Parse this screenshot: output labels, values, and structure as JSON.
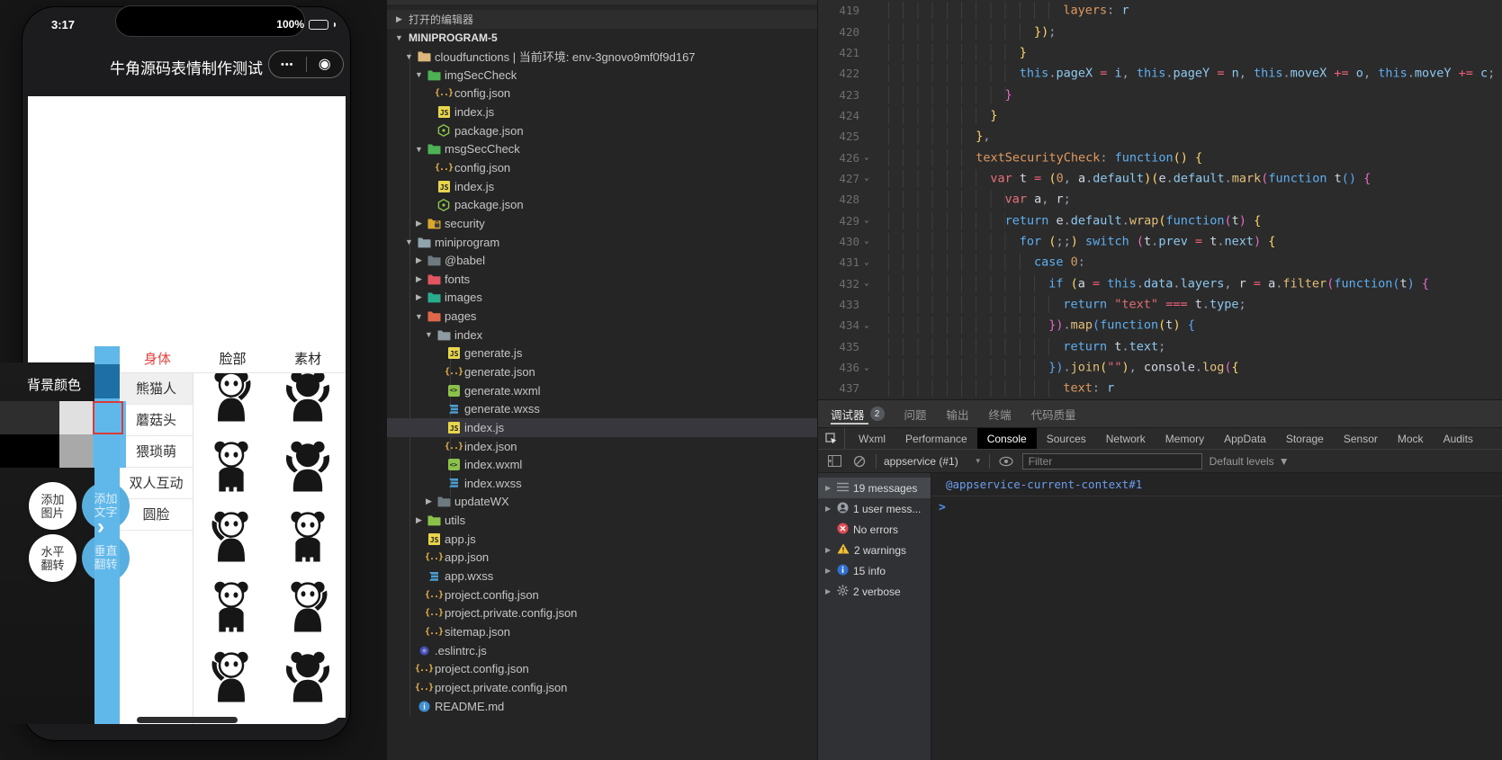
{
  "simulator": {
    "status": {
      "time": "3:17",
      "battery": "100%"
    },
    "navbar": {
      "title": "牛角源码表情制作测试",
      "menu_dots": "•••",
      "record_icon": "◉"
    },
    "tabs": [
      {
        "label": "身体",
        "active": true
      },
      {
        "label": "脸部",
        "active": false
      },
      {
        "label": "素材",
        "active": false
      }
    ],
    "categories": [
      {
        "label": "熊猫人",
        "active": true
      },
      {
        "label": "蘑菇头",
        "active": false
      },
      {
        "label": "猥琐萌",
        "active": false
      },
      {
        "label": "双人互动",
        "active": false
      },
      {
        "label": "圆脸",
        "active": false
      }
    ],
    "panel": {
      "bg_label": "背景颜色",
      "swatches": [
        [
          "#2e2e2e",
          "#e0e0e0",
          "#66b9ec"
        ],
        [
          "#000000",
          "#a9a9a9",
          "#66b9ec"
        ]
      ],
      "selected_border": "#d93a3a",
      "bar_color": "#5fb7ea",
      "bar_segment_color": "#1d6fa6",
      "chevron": "›",
      "buttons": [
        {
          "lines": [
            "添加",
            "图片"
          ],
          "style": "white"
        },
        {
          "lines": [
            "添加",
            "文字"
          ],
          "style": "blue"
        },
        {
          "lines": [
            "水平",
            "翻转"
          ],
          "style": "white"
        },
        {
          "lines": [
            "垂直",
            "翻转"
          ],
          "style": "blue"
        }
      ]
    },
    "accent_tab_red": "#e64340",
    "stickers": [
      {
        "v": "a",
        "flip": false
      },
      {
        "v": "b",
        "flip": true
      },
      {
        "v": "c",
        "flip": false
      },
      {
        "v": "b",
        "flip": false
      },
      {
        "v": "a",
        "flip": true
      },
      {
        "v": "c",
        "flip": true
      },
      {
        "v": "c",
        "flip": false
      },
      {
        "v": "a",
        "flip": false
      },
      {
        "v": "a",
        "flip": true
      },
      {
        "v": "b",
        "flip": false
      }
    ]
  },
  "tree": {
    "rows": [
      {
        "d": 0,
        "a": "r",
        "i": "",
        "label": "打开的编辑器",
        "hdr": 1
      },
      {
        "d": 0,
        "a": "d",
        "i": "",
        "label": "MINIPROGRAM-5",
        "hdr": 2
      },
      {
        "d": 1,
        "a": "d",
        "i": "folder",
        "ic": "#dcb67a",
        "label": "cloudfunctions | 当前环境: env-3gnovo9mf0f9d167"
      },
      {
        "d": 2,
        "a": "d",
        "i": "folder",
        "ic": "#4db254",
        "label": "imgSecCheck"
      },
      {
        "d": 3,
        "a": "",
        "i": "json",
        "label": "config.json"
      },
      {
        "d": 3,
        "a": "",
        "i": "js",
        "label": "index.js"
      },
      {
        "d": 3,
        "a": "",
        "i": "npm",
        "label": "package.json"
      },
      {
        "d": 2,
        "a": "d",
        "i": "folder",
        "ic": "#4db254",
        "label": "msgSecCheck"
      },
      {
        "d": 3,
        "a": "",
        "i": "json",
        "label": "config.json"
      },
      {
        "d": 3,
        "a": "",
        "i": "js",
        "label": "index.js"
      },
      {
        "d": 3,
        "a": "",
        "i": "npm",
        "label": "package.json"
      },
      {
        "d": 2,
        "a": "r",
        "i": "folder-lock",
        "ic": "#d9a62e",
        "label": "security"
      },
      {
        "d": 1,
        "a": "d",
        "i": "folder",
        "ic": "#90a4ae",
        "label": "miniprogram"
      },
      {
        "d": 2,
        "a": "r",
        "i": "folder",
        "ic": "#6d7a80",
        "label": "@babel"
      },
      {
        "d": 2,
        "a": "r",
        "i": "folder",
        "ic": "#e05561",
        "label": "fonts"
      },
      {
        "d": 2,
        "a": "r",
        "i": "folder",
        "ic": "#2bab8e",
        "label": "images"
      },
      {
        "d": 2,
        "a": "d",
        "i": "folder",
        "ic": "#e0674a",
        "label": "pages"
      },
      {
        "d": 3,
        "a": "d",
        "i": "folder",
        "ic": "#8e9ba3",
        "label": "index"
      },
      {
        "d": 4,
        "a": "",
        "i": "js",
        "label": "generate.js"
      },
      {
        "d": 4,
        "a": "",
        "i": "json",
        "label": "generate.json"
      },
      {
        "d": 4,
        "a": "",
        "i": "wxml",
        "label": "generate.wxml"
      },
      {
        "d": 4,
        "a": "",
        "i": "wxss",
        "label": "generate.wxss"
      },
      {
        "d": 4,
        "a": "",
        "i": "js",
        "label": "index.js",
        "sel": true
      },
      {
        "d": 4,
        "a": "",
        "i": "json",
        "label": "index.json"
      },
      {
        "d": 4,
        "a": "",
        "i": "wxml",
        "label": "index.wxml"
      },
      {
        "d": 4,
        "a": "",
        "i": "wxss",
        "label": "index.wxss"
      },
      {
        "d": 3,
        "a": "r",
        "i": "folder",
        "ic": "#6d7a80",
        "label": "updateWX"
      },
      {
        "d": 2,
        "a": "r",
        "i": "folder",
        "ic": "#8bc34a",
        "label": "utils"
      },
      {
        "d": 2,
        "a": "",
        "i": "js",
        "label": "app.js"
      },
      {
        "d": 2,
        "a": "",
        "i": "json",
        "label": "app.json"
      },
      {
        "d": 2,
        "a": "",
        "i": "wxss",
        "label": "app.wxss"
      },
      {
        "d": 2,
        "a": "",
        "i": "json",
        "label": "project.config.json"
      },
      {
        "d": 2,
        "a": "",
        "i": "json",
        "label": "project.private.config.json"
      },
      {
        "d": 2,
        "a": "",
        "i": "json",
        "label": "sitemap.json"
      },
      {
        "d": 1,
        "a": "",
        "i": "eslint",
        "label": ".eslintrc.js"
      },
      {
        "d": 1,
        "a": "",
        "i": "json",
        "label": "project.config.json"
      },
      {
        "d": 1,
        "a": "",
        "i": "json",
        "label": "project.private.config.json"
      },
      {
        "d": 1,
        "a": "",
        "i": "md",
        "label": "README.md"
      }
    ]
  },
  "editor": {
    "lines": [
      {
        "n": 419,
        "f": 0,
        "i": 12,
        "t": [
          [
            "layers",
            "key"
          ],
          [
            ": ",
            "pun"
          ],
          [
            "r",
            "pr"
          ]
        ]
      },
      {
        "n": 420,
        "f": 0,
        "i": 10,
        "t": [
          [
            "})",
            "by"
          ],
          [
            ";",
            "pun"
          ]
        ]
      },
      {
        "n": 421,
        "f": 0,
        "i": 9,
        "t": [
          [
            "}",
            "by"
          ]
        ]
      },
      {
        "n": 422,
        "f": 0,
        "i": 9,
        "t": [
          [
            "this",
            "kw"
          ],
          [
            ".",
            "pun"
          ],
          [
            "pageX",
            "pr"
          ],
          [
            " = ",
            "op"
          ],
          [
            "i",
            "pr"
          ],
          [
            ", ",
            "pun"
          ],
          [
            "this",
            "kw"
          ],
          [
            ".",
            "pun"
          ],
          [
            "pageY",
            "pr"
          ],
          [
            " = ",
            "op"
          ],
          [
            "n",
            "pr"
          ],
          [
            ", ",
            "pun"
          ],
          [
            "this",
            "kw"
          ],
          [
            ".",
            "pun"
          ],
          [
            "moveX",
            "pr"
          ],
          [
            " += ",
            "op"
          ],
          [
            "o",
            "pr"
          ],
          [
            ", ",
            "pun"
          ],
          [
            "this",
            "kw"
          ],
          [
            ".",
            "pun"
          ],
          [
            "moveY",
            "pr"
          ],
          [
            " += ",
            "op"
          ],
          [
            "c",
            "pr"
          ],
          [
            ";",
            "pun"
          ]
        ]
      },
      {
        "n": 423,
        "f": 0,
        "i": 8,
        "t": [
          [
            "}",
            "bp"
          ]
        ]
      },
      {
        "n": 424,
        "f": 0,
        "i": 7,
        "t": [
          [
            "}",
            "by"
          ]
        ]
      },
      {
        "n": 425,
        "f": 0,
        "i": 6,
        "t": [
          [
            "}",
            "by"
          ],
          [
            ",",
            "pun"
          ]
        ]
      },
      {
        "n": 426,
        "f": 1,
        "i": 6,
        "t": [
          [
            "textSecurityCheck",
            "key"
          ],
          [
            ": ",
            "pun"
          ],
          [
            "function",
            "kw"
          ],
          [
            "() {",
            "by"
          ]
        ]
      },
      {
        "n": 427,
        "f": 1,
        "i": 7,
        "t": [
          [
            "var ",
            "st"
          ],
          [
            "t",
            "id"
          ],
          [
            " = ",
            "op"
          ],
          [
            "(",
            "by"
          ],
          [
            "0",
            "num"
          ],
          [
            ", ",
            "pun"
          ],
          [
            "a",
            "id"
          ],
          [
            ".",
            "pun"
          ],
          [
            "default",
            "pr"
          ],
          [
            ")(",
            "by"
          ],
          [
            "e",
            "id"
          ],
          [
            ".",
            "pun"
          ],
          [
            "default",
            "pr"
          ],
          [
            ".",
            "pun"
          ],
          [
            "mark",
            "fn"
          ],
          [
            "(",
            "bp"
          ],
          [
            "function ",
            "kw"
          ],
          [
            "t",
            "id"
          ],
          [
            "()",
            "bb"
          ],
          [
            " {",
            "bp"
          ]
        ]
      },
      {
        "n": 428,
        "f": 0,
        "i": 8,
        "t": [
          [
            "var ",
            "st"
          ],
          [
            "a",
            "id"
          ],
          [
            ", ",
            "pun"
          ],
          [
            "r",
            "id"
          ],
          [
            ";",
            "pun"
          ]
        ]
      },
      {
        "n": 429,
        "f": 1,
        "i": 8,
        "t": [
          [
            "return ",
            "kw"
          ],
          [
            "e",
            "id"
          ],
          [
            ".",
            "pun"
          ],
          [
            "default",
            "pr"
          ],
          [
            ".",
            "pun"
          ],
          [
            "wrap",
            "fn"
          ],
          [
            "(",
            "by"
          ],
          [
            "function",
            "kw"
          ],
          [
            "(",
            "bp"
          ],
          [
            "t",
            "id"
          ],
          [
            ")",
            "bp"
          ],
          [
            " {",
            "by"
          ]
        ]
      },
      {
        "n": 430,
        "f": 1,
        "i": 9,
        "t": [
          [
            "for ",
            "kw"
          ],
          [
            "(",
            "by"
          ],
          [
            ";;",
            "pun"
          ],
          [
            ") ",
            "by"
          ],
          [
            "switch ",
            "kw"
          ],
          [
            "(",
            "bp"
          ],
          [
            "t",
            "id"
          ],
          [
            ".",
            "pun"
          ],
          [
            "prev",
            "pr"
          ],
          [
            " = ",
            "op"
          ],
          [
            "t",
            "id"
          ],
          [
            ".",
            "pun"
          ],
          [
            "next",
            "pr"
          ],
          [
            ") ",
            "bp"
          ],
          [
            "{",
            "by"
          ]
        ]
      },
      {
        "n": 431,
        "f": 1,
        "i": 10,
        "t": [
          [
            "case ",
            "kw"
          ],
          [
            "0",
            "num"
          ],
          [
            ":",
            "pun"
          ]
        ]
      },
      {
        "n": 432,
        "f": 1,
        "i": 11,
        "t": [
          [
            "if ",
            "kw"
          ],
          [
            "(",
            "by"
          ],
          [
            "a",
            "id"
          ],
          [
            " = ",
            "op"
          ],
          [
            "this",
            "kw"
          ],
          [
            ".",
            "pun"
          ],
          [
            "data",
            "pr"
          ],
          [
            ".",
            "pun"
          ],
          [
            "layers",
            "pr"
          ],
          [
            ", ",
            "pun"
          ],
          [
            "r",
            "id"
          ],
          [
            " = ",
            "op"
          ],
          [
            "a",
            "id"
          ],
          [
            ".",
            "pun"
          ],
          [
            "filter",
            "fn"
          ],
          [
            "(",
            "bp"
          ],
          [
            "function",
            "kw"
          ],
          [
            "(",
            "bb"
          ],
          [
            "t",
            "id"
          ],
          [
            ")",
            "bb"
          ],
          [
            " {",
            "bp"
          ]
        ]
      },
      {
        "n": 433,
        "f": 0,
        "i": 12,
        "t": [
          [
            "return ",
            "kw"
          ],
          [
            "\"text\"",
            "str"
          ],
          [
            " === ",
            "op"
          ],
          [
            "t",
            "id"
          ],
          [
            ".",
            "pun"
          ],
          [
            "type",
            "pr"
          ],
          [
            ";",
            "pun"
          ]
        ]
      },
      {
        "n": 434,
        "f": 1,
        "i": 11,
        "t": [
          [
            "})",
            "bp"
          ],
          [
            ".",
            "pun"
          ],
          [
            "map",
            "fn"
          ],
          [
            "(",
            "bb"
          ],
          [
            "function",
            "kw"
          ],
          [
            "(",
            "by"
          ],
          [
            "t",
            "id"
          ],
          [
            ")",
            "by"
          ],
          [
            " {",
            "bb"
          ]
        ]
      },
      {
        "n": 435,
        "f": 0,
        "i": 12,
        "t": [
          [
            "return ",
            "kw"
          ],
          [
            "t",
            "id"
          ],
          [
            ".",
            "pun"
          ],
          [
            "text",
            "pr"
          ],
          [
            ";",
            "pun"
          ]
        ]
      },
      {
        "n": 436,
        "f": 1,
        "i": 11,
        "t": [
          [
            "})",
            "bb"
          ],
          [
            ".",
            "pun"
          ],
          [
            "join",
            "fn"
          ],
          [
            "(",
            "by"
          ],
          [
            "\"\"",
            "str"
          ],
          [
            ")",
            "by"
          ],
          [
            ", ",
            "pun"
          ],
          [
            "console",
            "id"
          ],
          [
            ".",
            "pun"
          ],
          [
            "log",
            "fn"
          ],
          [
            "(",
            "bp"
          ],
          [
            "{",
            "by"
          ]
        ]
      },
      {
        "n": 437,
        "f": 0,
        "i": 12,
        "t": [
          [
            "text",
            "key"
          ],
          [
            ": ",
            "pun"
          ],
          [
            "r",
            "pr"
          ]
        ]
      }
    ]
  },
  "debugger": {
    "strip_tabs": [
      {
        "label": "调试器",
        "badge": "2",
        "active": true
      },
      {
        "label": "问题",
        "active": false
      },
      {
        "label": "输出",
        "active": false
      },
      {
        "label": "终端",
        "active": false
      },
      {
        "label": "代码质量",
        "active": false
      }
    ],
    "devtools_tabs": [
      {
        "label": "Wxml"
      },
      {
        "label": "Performance"
      },
      {
        "label": "Console",
        "active": true
      },
      {
        "label": "Sources"
      },
      {
        "label": "Network"
      },
      {
        "label": "Memory"
      },
      {
        "label": "AppData"
      },
      {
        "label": "Storage"
      },
      {
        "label": "Sensor"
      },
      {
        "label": "Mock"
      },
      {
        "label": "Audits"
      }
    ],
    "toolbar": {
      "context": "appservice (#1)",
      "filter_placeholder": "Filter",
      "levels_label": "Default levels"
    },
    "sidebar": [
      {
        "arrow": true,
        "icon": "list",
        "label": "19 messages",
        "sel": true
      },
      {
        "arrow": true,
        "icon": "user",
        "label": "1 user mess..."
      },
      {
        "arrow": false,
        "icon": "error",
        "label": "No errors"
      },
      {
        "arrow": true,
        "icon": "warn",
        "label": "2 warnings"
      },
      {
        "arrow": true,
        "icon": "info",
        "label": "15 info"
      },
      {
        "arrow": true,
        "icon": "verbose",
        "label": "2 verbose"
      }
    ],
    "console": {
      "context_line": "@appservice-current-context#1",
      "prompt": ">"
    }
  }
}
